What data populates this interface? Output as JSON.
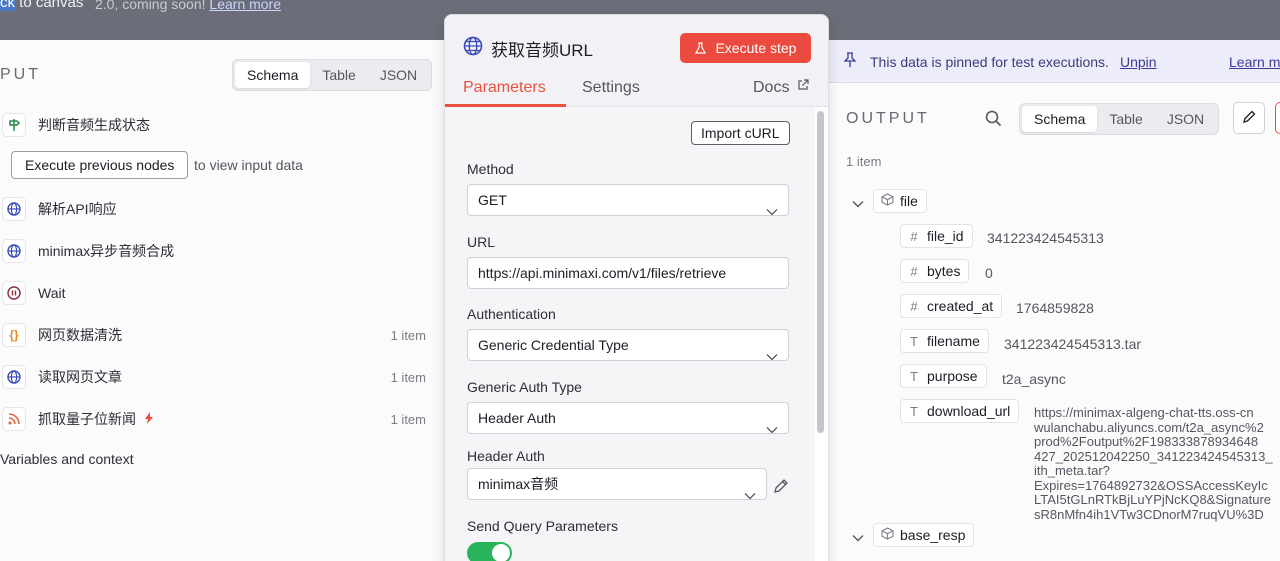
{
  "backdrop": {
    "back_label_highlight": "ck",
    "back_label_rest": " to canvas",
    "note_text": "2.0, coming soon! ",
    "note_link": "Learn more"
  },
  "input": {
    "title": "PUT",
    "view_tabs": [
      "Schema",
      "Table",
      "JSON"
    ],
    "active_view": "Schema",
    "nodes": [
      {
        "label": "判断音频生成状态",
        "icon": "signpost-icon",
        "count": ""
      },
      {
        "label": "解析API响应",
        "icon": "globe-icon",
        "count": ""
      },
      {
        "label": "minimax异步音频合成",
        "icon": "globe-icon",
        "count": ""
      },
      {
        "label": "Wait",
        "icon": "pause-icon",
        "count": ""
      },
      {
        "label": "网页数据清洗",
        "icon": "code-braces-icon",
        "count": "1 item"
      },
      {
        "label": "读取网页文章",
        "icon": "globe-icon",
        "count": "1 item"
      },
      {
        "label": "抓取量子位新闻",
        "icon": "rss-icon",
        "count": "1 item"
      }
    ],
    "execute_previous_label": "Execute previous nodes",
    "execute_previous_hint": "to view input data",
    "variables_label": "Variables and context"
  },
  "modal": {
    "title": "获取音频URL",
    "execute_step_label": "Execute step",
    "tabs": [
      "Parameters",
      "Settings"
    ],
    "active_tab": "Parameters",
    "docs_label": "Docs",
    "import_curl_label": "Import cURL",
    "method_label": "Method",
    "method_value": "GET",
    "url_label": "URL",
    "url_value": "https://api.minimaxi.com/v1/files/retrieve",
    "auth_label": "Authentication",
    "auth_value": "Generic Credential Type",
    "generic_auth_label": "Generic Auth Type",
    "generic_auth_value": "Header Auth",
    "header_auth_label": "Header Auth",
    "header_auth_value": "minimax音频",
    "send_query_label": "Send Query Parameters",
    "send_query_on": true
  },
  "output": {
    "pinned_text": "This data is pinned for test executions.",
    "unpin_label": "Unpin",
    "learn_more_label": "Learn m",
    "title": "OUTPUT",
    "view_tabs": [
      "Schema",
      "Table",
      "JSON"
    ],
    "active_view": "Schema",
    "item_count": "1 item",
    "tree": {
      "file_key": "file",
      "fields": [
        {
          "type_icon": "#",
          "key": "file_id",
          "value": "341223424545313"
        },
        {
          "type_icon": "#",
          "key": "bytes",
          "value": "0"
        },
        {
          "type_icon": "#",
          "key": "created_at",
          "value": "1764859828"
        },
        {
          "type_icon": "T",
          "key": "filename",
          "value": "341223424545313.tar"
        },
        {
          "type_icon": "T",
          "key": "purpose",
          "value": "t2a_async"
        },
        {
          "type_icon": "T",
          "key": "download_url",
          "value": "https://minimax-algeng-chat-tts.oss-cn\nwulanchabu.aliyuncs.com/t2a_async%2\nprod%2Foutput%2F198333878934648\n427_202512042250_341223424545313_\nith_meta.tar?\nExpires=1764892732&OSSAccessKeyIc\nLTAI5tGLnRTkBjLuYPjNcKQ8&Signature\nsR8nMfn4ih1VTw3CDnorM7ruqVU%3D"
        }
      ],
      "base_resp_key": "base_resp"
    }
  },
  "colors": {
    "accent": "#e9523f",
    "execute_button": "#ea4b3e",
    "toggle_on": "#29b35a",
    "pinned_bg": "#ececfb"
  }
}
